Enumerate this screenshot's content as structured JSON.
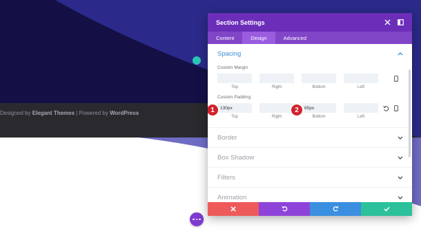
{
  "background": {
    "footer_text_prefix": "Designed by ",
    "footer_brand": "Elegant Themes",
    "footer_separator": " | Powered by ",
    "footer_platform": "WordPress",
    "colors": {
      "dark_navy": "#141046",
      "indigo": "#2b2a8a",
      "purple_band": "#6f6cc4"
    }
  },
  "modal": {
    "title": "Section Settings",
    "header_icons": [
      "close-icon",
      "expand-sidebar-icon"
    ],
    "tabs": [
      {
        "label": "Content",
        "active": false
      },
      {
        "label": "Design",
        "active": true
      },
      {
        "label": "Advanced",
        "active": false
      }
    ],
    "spacing": {
      "title": "Spacing",
      "margin": {
        "label": "Custom Margin",
        "fields": [
          {
            "sub": "Top",
            "value": ""
          },
          {
            "sub": "Right",
            "value": ""
          },
          {
            "sub": "Bottom",
            "value": ""
          },
          {
            "sub": "Left",
            "value": ""
          }
        ]
      },
      "padding": {
        "label": "Custom Padding",
        "fields": [
          {
            "sub": "Top",
            "value": "130px"
          },
          {
            "sub": "Right",
            "value": ""
          },
          {
            "sub": "Bottom",
            "value": "65px"
          },
          {
            "sub": "Left",
            "value": ""
          }
        ]
      }
    },
    "collapsed_sections": [
      "Border",
      "Box Shadow",
      "Filters",
      "Animation"
    ],
    "footer_icons": [
      "cancel-icon",
      "undo-icon",
      "redo-icon",
      "save-icon"
    ],
    "accent_color": "#6c2eb9",
    "open_section_color": "#3d8ad6"
  },
  "annotations": {
    "badge_1": "1",
    "badge_2": "2"
  }
}
